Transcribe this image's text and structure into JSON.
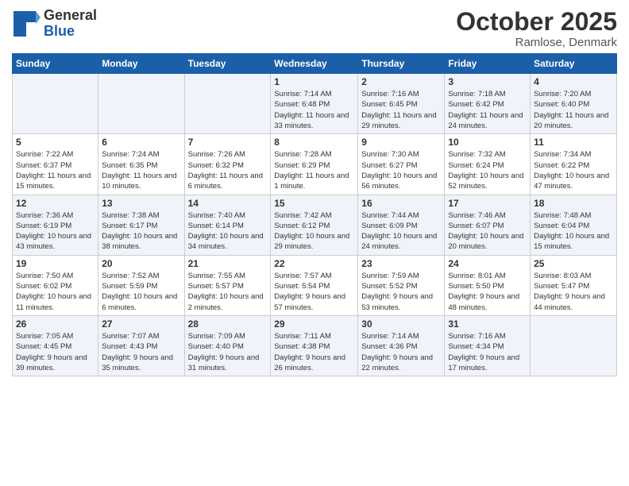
{
  "header": {
    "logo_general": "General",
    "logo_blue": "Blue",
    "month": "October 2025",
    "location": "Ramlose, Denmark"
  },
  "days_of_week": [
    "Sunday",
    "Monday",
    "Tuesday",
    "Wednesday",
    "Thursday",
    "Friday",
    "Saturday"
  ],
  "weeks": [
    [
      {
        "day": "",
        "info": ""
      },
      {
        "day": "",
        "info": ""
      },
      {
        "day": "",
        "info": ""
      },
      {
        "day": "1",
        "info": "Sunrise: 7:14 AM\nSunset: 6:48 PM\nDaylight: 11 hours\nand 33 minutes."
      },
      {
        "day": "2",
        "info": "Sunrise: 7:16 AM\nSunset: 6:45 PM\nDaylight: 11 hours\nand 29 minutes."
      },
      {
        "day": "3",
        "info": "Sunrise: 7:18 AM\nSunset: 6:42 PM\nDaylight: 11 hours\nand 24 minutes."
      },
      {
        "day": "4",
        "info": "Sunrise: 7:20 AM\nSunset: 6:40 PM\nDaylight: 11 hours\nand 20 minutes."
      }
    ],
    [
      {
        "day": "5",
        "info": "Sunrise: 7:22 AM\nSunset: 6:37 PM\nDaylight: 11 hours\nand 15 minutes."
      },
      {
        "day": "6",
        "info": "Sunrise: 7:24 AM\nSunset: 6:35 PM\nDaylight: 11 hours\nand 10 minutes."
      },
      {
        "day": "7",
        "info": "Sunrise: 7:26 AM\nSunset: 6:32 PM\nDaylight: 11 hours\nand 6 minutes."
      },
      {
        "day": "8",
        "info": "Sunrise: 7:28 AM\nSunset: 6:29 PM\nDaylight: 11 hours\nand 1 minute."
      },
      {
        "day": "9",
        "info": "Sunrise: 7:30 AM\nSunset: 6:27 PM\nDaylight: 10 hours\nand 56 minutes."
      },
      {
        "day": "10",
        "info": "Sunrise: 7:32 AM\nSunset: 6:24 PM\nDaylight: 10 hours\nand 52 minutes."
      },
      {
        "day": "11",
        "info": "Sunrise: 7:34 AM\nSunset: 6:22 PM\nDaylight: 10 hours\nand 47 minutes."
      }
    ],
    [
      {
        "day": "12",
        "info": "Sunrise: 7:36 AM\nSunset: 6:19 PM\nDaylight: 10 hours\nand 43 minutes."
      },
      {
        "day": "13",
        "info": "Sunrise: 7:38 AM\nSunset: 6:17 PM\nDaylight: 10 hours\nand 38 minutes."
      },
      {
        "day": "14",
        "info": "Sunrise: 7:40 AM\nSunset: 6:14 PM\nDaylight: 10 hours\nand 34 minutes."
      },
      {
        "day": "15",
        "info": "Sunrise: 7:42 AM\nSunset: 6:12 PM\nDaylight: 10 hours\nand 29 minutes."
      },
      {
        "day": "16",
        "info": "Sunrise: 7:44 AM\nSunset: 6:09 PM\nDaylight: 10 hours\nand 24 minutes."
      },
      {
        "day": "17",
        "info": "Sunrise: 7:46 AM\nSunset: 6:07 PM\nDaylight: 10 hours\nand 20 minutes."
      },
      {
        "day": "18",
        "info": "Sunrise: 7:48 AM\nSunset: 6:04 PM\nDaylight: 10 hours\nand 15 minutes."
      }
    ],
    [
      {
        "day": "19",
        "info": "Sunrise: 7:50 AM\nSunset: 6:02 PM\nDaylight: 10 hours\nand 11 minutes."
      },
      {
        "day": "20",
        "info": "Sunrise: 7:52 AM\nSunset: 5:59 PM\nDaylight: 10 hours\nand 6 minutes."
      },
      {
        "day": "21",
        "info": "Sunrise: 7:55 AM\nSunset: 5:57 PM\nDaylight: 10 hours\nand 2 minutes."
      },
      {
        "day": "22",
        "info": "Sunrise: 7:57 AM\nSunset: 5:54 PM\nDaylight: 9 hours\nand 57 minutes."
      },
      {
        "day": "23",
        "info": "Sunrise: 7:59 AM\nSunset: 5:52 PM\nDaylight: 9 hours\nand 53 minutes."
      },
      {
        "day": "24",
        "info": "Sunrise: 8:01 AM\nSunset: 5:50 PM\nDaylight: 9 hours\nand 48 minutes."
      },
      {
        "day": "25",
        "info": "Sunrise: 8:03 AM\nSunset: 5:47 PM\nDaylight: 9 hours\nand 44 minutes."
      }
    ],
    [
      {
        "day": "26",
        "info": "Sunrise: 7:05 AM\nSunset: 4:45 PM\nDaylight: 9 hours\nand 39 minutes."
      },
      {
        "day": "27",
        "info": "Sunrise: 7:07 AM\nSunset: 4:43 PM\nDaylight: 9 hours\nand 35 minutes."
      },
      {
        "day": "28",
        "info": "Sunrise: 7:09 AM\nSunset: 4:40 PM\nDaylight: 9 hours\nand 31 minutes."
      },
      {
        "day": "29",
        "info": "Sunrise: 7:11 AM\nSunset: 4:38 PM\nDaylight: 9 hours\nand 26 minutes."
      },
      {
        "day": "30",
        "info": "Sunrise: 7:14 AM\nSunset: 4:36 PM\nDaylight: 9 hours\nand 22 minutes."
      },
      {
        "day": "31",
        "info": "Sunrise: 7:16 AM\nSunset: 4:34 PM\nDaylight: 9 hours\nand 17 minutes."
      },
      {
        "day": "",
        "info": ""
      }
    ]
  ]
}
